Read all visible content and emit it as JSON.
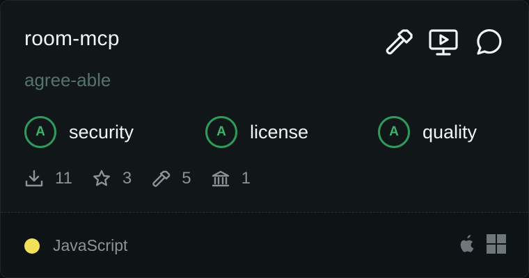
{
  "server": {
    "name": "room-mcp",
    "author": "agree-able"
  },
  "top_icons": [
    "hammer-icon",
    "monitor-play-icon",
    "chat-bubble-icon"
  ],
  "grades": [
    {
      "grade": "A",
      "label": "security"
    },
    {
      "grade": "A",
      "label": "license"
    },
    {
      "grade": "A",
      "label": "quality"
    }
  ],
  "stats": {
    "downloads": "11",
    "stars": "3",
    "tools": "5",
    "institutions": "1"
  },
  "footer": {
    "language": "JavaScript",
    "language_color": "#f1e05a",
    "platforms": [
      "apple-icon",
      "windows-icon"
    ]
  },
  "colors": {
    "grade_accent": "#3fb26d",
    "background": "#111719",
    "muted_text": "#8a9496"
  }
}
